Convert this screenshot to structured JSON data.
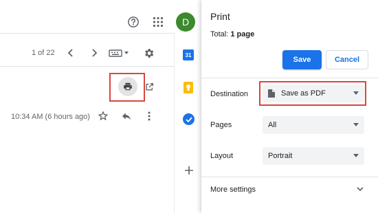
{
  "gmail": {
    "avatar_letter": "D",
    "pagination": "1 of 22",
    "timestamp": "10:34 AM (6 hours ago)",
    "calendar_day": "31"
  },
  "print": {
    "title": "Print",
    "total_label": "Total:",
    "total_value": "1 page",
    "save_label": "Save",
    "cancel_label": "Cancel",
    "destination_label": "Destination",
    "destination_value": "Save as PDF",
    "pages_label": "Pages",
    "pages_value": "All",
    "layout_label": "Layout",
    "layout_value": "Portrait",
    "more_settings_label": "More settings"
  },
  "colors": {
    "accent": "#1a73e8",
    "highlight": "#d9453d",
    "avatar": "#3c8a2e"
  },
  "icons": [
    "help-icon",
    "apps-icon",
    "chevron-left-icon",
    "chevron-right-icon",
    "keyboard-icon",
    "settings-icon",
    "print-icon",
    "open-new-window-icon",
    "star-icon",
    "reply-icon",
    "more-vert-icon",
    "calendar-icon",
    "keep-icon",
    "tasks-icon",
    "add-icon",
    "file-icon",
    "expand-icon"
  ]
}
